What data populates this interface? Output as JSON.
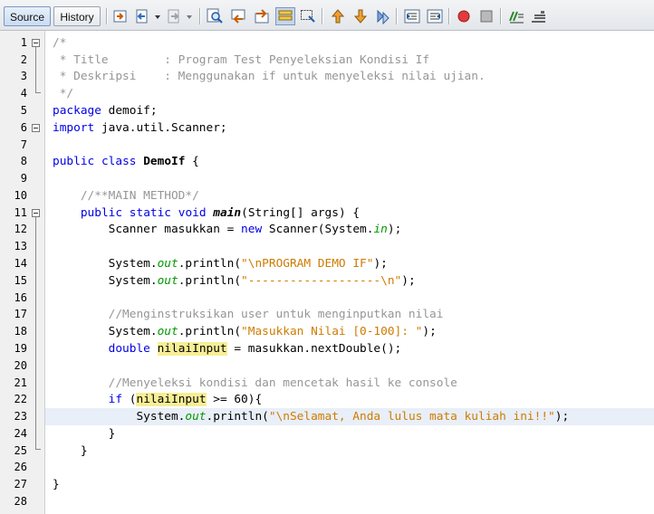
{
  "tabs": [
    {
      "label": "Source",
      "active": true
    },
    {
      "label": "History",
      "active": false
    }
  ],
  "toolbar_icons": [
    "last-edit-icon",
    "back-icon",
    "forward-icon",
    "find-icon",
    "find-previous-icon",
    "find-next-icon",
    "toggle-highlight-icon",
    "find-selection-icon",
    "shift-line-up-icon",
    "shift-line-down-icon",
    "bookmark-icon",
    "shift-left-icon",
    "shift-right-icon",
    "record-macro-icon",
    "stop-macro-icon",
    "comment-icon",
    "uncomment-icon"
  ],
  "line_numbers": [
    "1",
    "2",
    "3",
    "4",
    "5",
    "6",
    "7",
    "8",
    "9",
    "10",
    "11",
    "12",
    "13",
    "14",
    "15",
    "16",
    "17",
    "18",
    "19",
    "20",
    "21",
    "22",
    "23",
    "24",
    "25",
    "26",
    "27",
    "28"
  ],
  "code": {
    "l1": "/*",
    "l2": " * Title        : Program Test Penyeleksian Kondisi If",
    "l3": " * Deskripsi    : Menggunakan if untuk menyeleksi nilai ujian.",
    "l4": " */",
    "l5_kw": "package",
    "l5_rest": " demoif;",
    "l6_kw": "import",
    "l6_rest": " java.util.Scanner;",
    "l8_kw1": "public",
    "l8_kw2": "class",
    "l8_name": "DemoIf",
    "l8_rest": " {",
    "l10": "    //**MAIN METHOD*/",
    "l11_kw1": "public",
    "l11_kw2": "static",
    "l11_kw3": "void",
    "l11_name": "main",
    "l11_rest": "(String[] args) {",
    "l12_a": "        Scanner masukkan = ",
    "l12_kw": "new",
    "l12_b": " Scanner(System.",
    "l12_sf": "in",
    "l12_c": ");",
    "l14_a": "        System.",
    "l14_sf": "out",
    "l14_b": ".println(",
    "l14_st": "\"\\nPROGRAM DEMO IF\"",
    "l14_c": ");",
    "l15_a": "        System.",
    "l15_sf": "out",
    "l15_b": ".println(",
    "l15_st": "\"-------------------\\n\"",
    "l15_c": ");",
    "l17": "        //Menginstruksikan user untuk menginputkan nilai",
    "l18_a": "        System.",
    "l18_sf": "out",
    "l18_b": ".println(",
    "l18_st": "\"Masukkan Nilai [0-100]: \"",
    "l18_c": ");",
    "l19_kw": "double",
    "l19_hl": "nilaiInput",
    "l19_rest": " = masukkan.nextDouble();",
    "l21": "        //Menyeleksi kondisi dan mencetak hasil ke console",
    "l22_kw": "if",
    "l22_a": " (",
    "l22_hl": "nilaiInput",
    "l22_b": " >= 60){",
    "l23_a": "            System.",
    "l23_sf": "out",
    "l23_b": ".println(",
    "l23_st": "\"\\nSelamat, Anda lulus mata kuliah ini!!\"",
    "l23_c": ");",
    "l24": "        }",
    "l25": "    }",
    "l27": "}"
  },
  "colors": {
    "keyword": "#0000e6",
    "string": "#ce7b00",
    "comment": "#969696",
    "static_field": "#009900",
    "highlight": "#f7ee96",
    "current_line": "#e9eff8"
  }
}
